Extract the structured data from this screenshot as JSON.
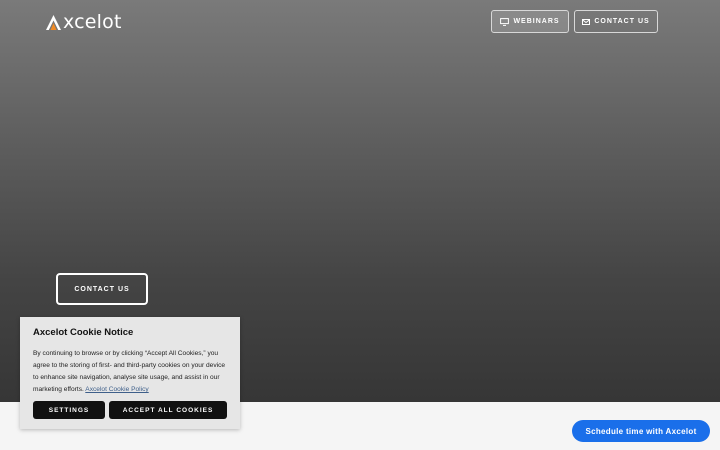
{
  "brand": {
    "logo_text": "xcelot",
    "logo_accent": "#f08a24"
  },
  "nav": {
    "webinars": {
      "label": "WEBINARS",
      "icon": "monitor-icon"
    },
    "contact": {
      "label": "CONTACT US",
      "icon": "mail-icon"
    }
  },
  "hero": {
    "contact_label": "CONTACT US"
  },
  "cookie": {
    "title": "Axcelot Cookie Notice",
    "body": "By continuing to browse or by clicking “Accept All Cookies,” you agree to the storing of first- and third-party cookies on your device to enhance site navigation, analyse site usage, and assist in our marketing efforts.",
    "link_label": "Axcelot Cookie Policy",
    "settings_label": "SETTINGS",
    "accept_label": "ACCEPT ALL COOKIES"
  },
  "chat": {
    "label": "Schedule time with Axcelot",
    "color": "#1a6fea"
  }
}
